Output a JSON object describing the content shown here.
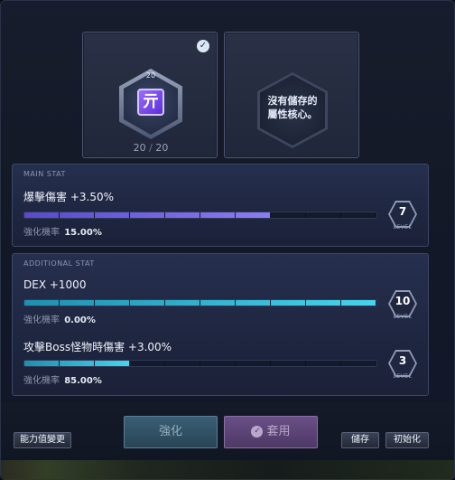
{
  "core_slot": {
    "level_tag": "20",
    "glyph": "亓",
    "count_current": "20",
    "count_separator": "/",
    "count_max": "20",
    "selected_icon": "check-icon"
  },
  "empty_slot": {
    "message_line1": "沒有儲存的",
    "message_line2": "屬性核心。"
  },
  "main_stat": {
    "section_title": "MAIN STAT",
    "name": "爆擊傷害 +3.50%",
    "rate_label": "強化機率",
    "rate_value": "15.00%",
    "progress": 0.7,
    "level": "7",
    "level_word": "LEVEL",
    "bar_color": "#8d7df2"
  },
  "additional_stat": {
    "section_title": "ADDITIONAL STAT",
    "stats": [
      {
        "name": "DEX +1000",
        "rate_label": "強化機率",
        "rate_value": "0.00%",
        "progress": 1.0,
        "level": "10",
        "level_word": "LEVEL"
      },
      {
        "name": "攻擊Boss怪物時傷害 +3.00%",
        "rate_label": "強化機率",
        "rate_value": "85.00%",
        "progress": 0.3,
        "level": "3",
        "level_word": "LEVEL"
      }
    ],
    "bar_color": "#47d4ec"
  },
  "buttons": {
    "change_stat": "能力值變更",
    "enhance": "強化",
    "apply": "套用",
    "apply_icon": "check-circle-icon",
    "save": "儲存",
    "reset": "初始化"
  }
}
